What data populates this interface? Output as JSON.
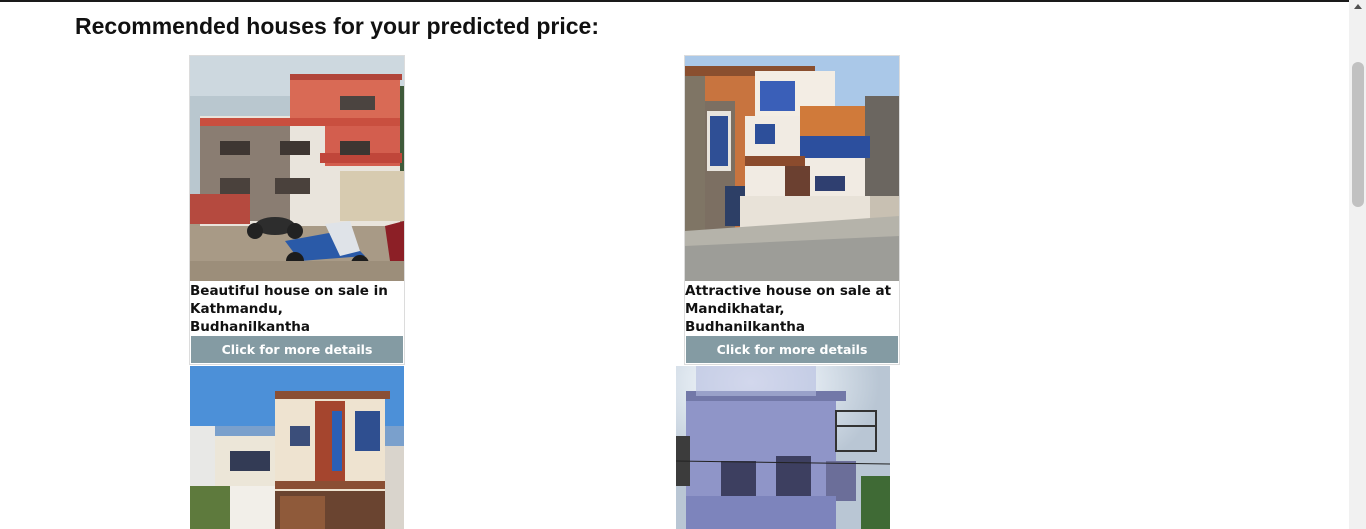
{
  "heading": "Recommended houses for your predicted price:",
  "houses": [
    {
      "title": "Beautiful house on sale in Kathmandu, Budhanilkantha",
      "button": "Click for more details"
    },
    {
      "title": "Attractive house on sale at Mandikhatar, Budhanilkantha",
      "button": "Click for more details"
    },
    {
      "title": "",
      "button": ""
    },
    {
      "title": "",
      "button": ""
    }
  ],
  "colors": {
    "button_bg": "#849ba3",
    "button_text": "#ffffff",
    "heading": "#111111"
  }
}
